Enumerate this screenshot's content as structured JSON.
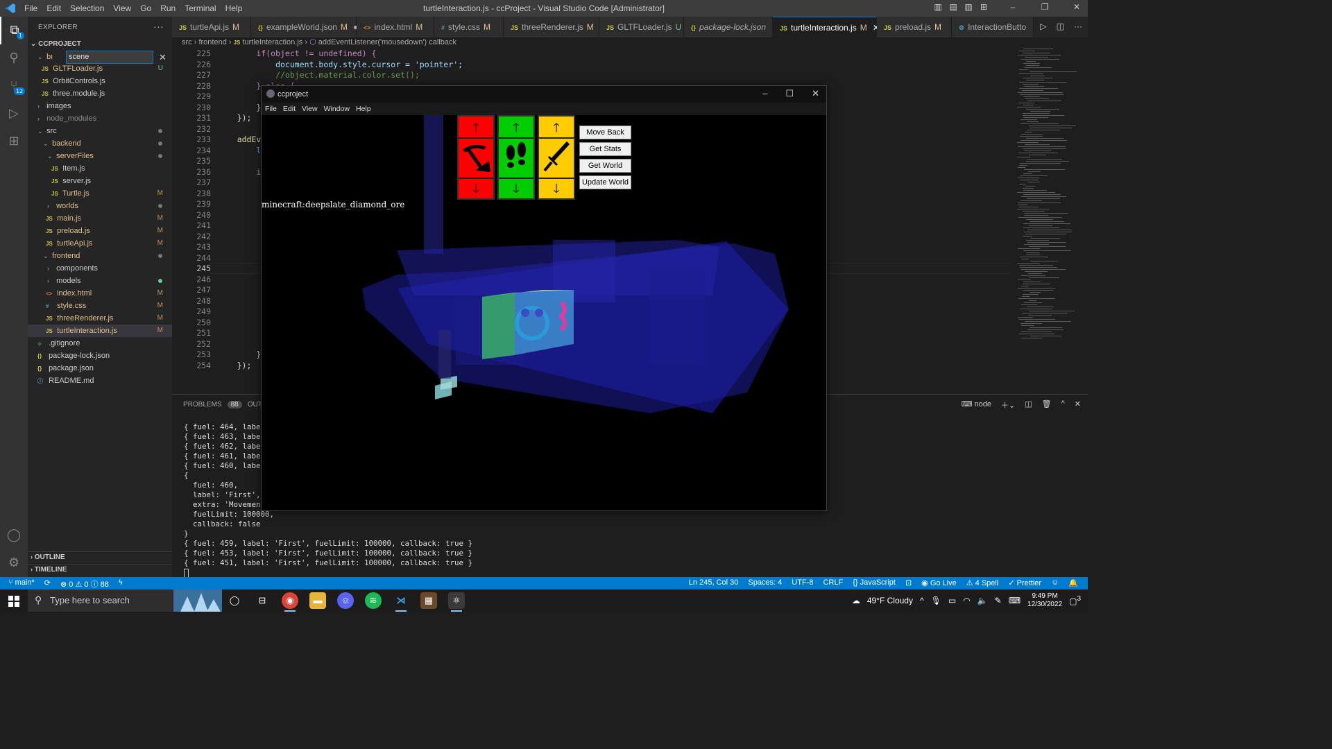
{
  "titlebar": {
    "title": "turtleInteraction.js - ccProject - Visual Studio Code [Administrator]",
    "menu": [
      "File",
      "Edit",
      "Selection",
      "View",
      "Go",
      "Run",
      "Terminal",
      "Help"
    ]
  },
  "activity": {
    "explorer_badge": "1",
    "scm_badge": "12"
  },
  "sidebar": {
    "header": "EXPLORER",
    "project": "CCPROJECT",
    "filter_value": "scene",
    "items": [
      {
        "label": "GLTFLoader.js",
        "status": "U"
      },
      {
        "label": "OrbitControls.js",
        "status": ""
      },
      {
        "label": "three.module.js",
        "status": ""
      },
      {
        "label": "images",
        "status": ""
      },
      {
        "label": "node_modules",
        "status": ""
      },
      {
        "label": "src",
        "status": ""
      },
      {
        "label": "backend",
        "status": ""
      },
      {
        "label": "serverFiles",
        "status": ""
      },
      {
        "label": "Item.js",
        "status": ""
      },
      {
        "label": "server.js",
        "status": ""
      },
      {
        "label": "Turtle.js",
        "status": "M"
      },
      {
        "label": "worlds",
        "status": ""
      },
      {
        "label": "main.js",
        "status": "M"
      },
      {
        "label": "preload.js",
        "status": "M"
      },
      {
        "label": "turtleApi.js",
        "status": "M"
      },
      {
        "label": "frontend",
        "status": ""
      },
      {
        "label": "components",
        "status": ""
      },
      {
        "label": "models",
        "status": ""
      },
      {
        "label": "index.html",
        "status": "M"
      },
      {
        "label": "style.css",
        "status": "M"
      },
      {
        "label": "threeRenderer.js",
        "status": "M"
      },
      {
        "label": "turtleInteraction.js",
        "status": "M"
      },
      {
        "label": ".gitignore",
        "status": ""
      },
      {
        "label": "package-lock.json",
        "status": ""
      },
      {
        "label": "package.json",
        "status": ""
      },
      {
        "label": "README.md",
        "status": ""
      }
    ],
    "outline": "OUTLINE",
    "timeline": "TIMELINE"
  },
  "tabs": [
    {
      "label": "turtleApi.js",
      "mark": "M"
    },
    {
      "label": "exampleWorld.json",
      "mark": "M"
    },
    {
      "label": "index.html",
      "mark": "M"
    },
    {
      "label": "style.css",
      "mark": "M"
    },
    {
      "label": "threeRenderer.js",
      "mark": "M"
    },
    {
      "label": "GLTFLoader.js",
      "mark": "U"
    },
    {
      "label": "package-lock.json",
      "mark": ""
    },
    {
      "label": "turtleInteraction.js",
      "mark": "M"
    },
    {
      "label": "preload.js",
      "mark": "M"
    },
    {
      "label": "InteractionButto",
      "mark": ""
    }
  ],
  "breadcrumb": [
    "src",
    "frontend",
    "turtleInteraction.js",
    "addEventListener('mousedown') callback"
  ],
  "editor": {
    "lines": [
      {
        "n": "225",
        "code": "        if(object != undefined) {"
      },
      {
        "n": "226",
        "code": "            document.body.style.cursor = 'pointer';"
      },
      {
        "n": "227",
        "code": "            //object.material.color.set();"
      },
      {
        "n": "228",
        "code": "        } else {"
      },
      {
        "n": "229",
        "code": "            docu"
      },
      {
        "n": "230",
        "code": "        }"
      },
      {
        "n": "231",
        "code": "    });"
      },
      {
        "n": "232",
        "code": ""
      },
      {
        "n": "233",
        "code": "    addEventList"
      },
      {
        "n": "234",
        "code": "        let obje"
      },
      {
        "n": "235",
        "code": ""
      },
      {
        "n": "236",
        "code": "        if(objec"
      },
      {
        "n": "237",
        "code": "            cons"
      },
      {
        "n": "238",
        "code": "            obje"
      },
      {
        "n": "239",
        "code": ""
      },
      {
        "n": "240",
        "code": "            let"
      },
      {
        "n": "241",
        "code": "            if(l"
      },
      {
        "n": "242",
        "code": ""
      },
      {
        "n": "243",
        "code": "            }"
      },
      {
        "n": "244",
        "code": ""
      },
      {
        "n": "245",
        "code": "            //Sc"
      },
      {
        "n": "246",
        "code": "            /*"
      },
      {
        "n": "247",
        "code": "            scen"
      },
      {
        "n": "248",
        "code": "            var"
      },
      {
        "n": "249",
        "code": "            posi"
      },
      {
        "n": "250",
        "code": ""
      },
      {
        "n": "251",
        "code": "            cont"
      },
      {
        "n": "252",
        "code": "            */"
      },
      {
        "n": "253",
        "code": "        }"
      },
      {
        "n": "254",
        "code": "    });"
      }
    ]
  },
  "panel": {
    "problems_label": "PROBLEMS",
    "problems_count": "88",
    "output_label": "OUTP",
    "terminal_name": "node",
    "lines": [
      "{ fuel: 464, label:",
      "{ fuel: 463, label:",
      "{ fuel: 462, label:",
      "{ fuel: 461, label:",
      "{ fuel: 460, label:",
      "{",
      "  fuel: 460,",
      "  label: 'First',",
      "  extra: 'Movement c",
      "  fuelLimit: 100000,",
      "  callback: false",
      "}",
      "{ fuel: 459, label: 'First', fuelLimit: 100000, callback: true }",
      "{ fuel: 453, label: 'First', fuelLimit: 100000, callback: true }",
      "{ fuel: 451, label: 'First', fuelLimit: 100000, callback: true }"
    ]
  },
  "status": {
    "branch": "main*",
    "errors": "0",
    "warnings": "0",
    "infos": "88",
    "position": "Ln 245, Col 30",
    "spaces": "Spaces: 4",
    "encoding": "UTF-8",
    "eol": "CRLF",
    "language": "JavaScript",
    "golive": "Go Live",
    "spell": "4 Spell",
    "prettier": "Prettier"
  },
  "taskbar": {
    "search_placeholder": "Type here to search",
    "weather": "49°F  Cloudy",
    "time": "9:49 PM",
    "date": "12/30/2022",
    "notif": "3"
  },
  "app": {
    "title": "ccproject",
    "menu": [
      "File",
      "Edit",
      "View",
      "Window",
      "Help"
    ],
    "block_label": "minecraft:deepslate_diamond_ore",
    "buttons": [
      "Move Back",
      "Get Stats",
      "Get World",
      "Update World"
    ],
    "colors": {
      "dig": "#ff0000",
      "move": "#00cc00",
      "attack": "#ffcc00"
    }
  }
}
